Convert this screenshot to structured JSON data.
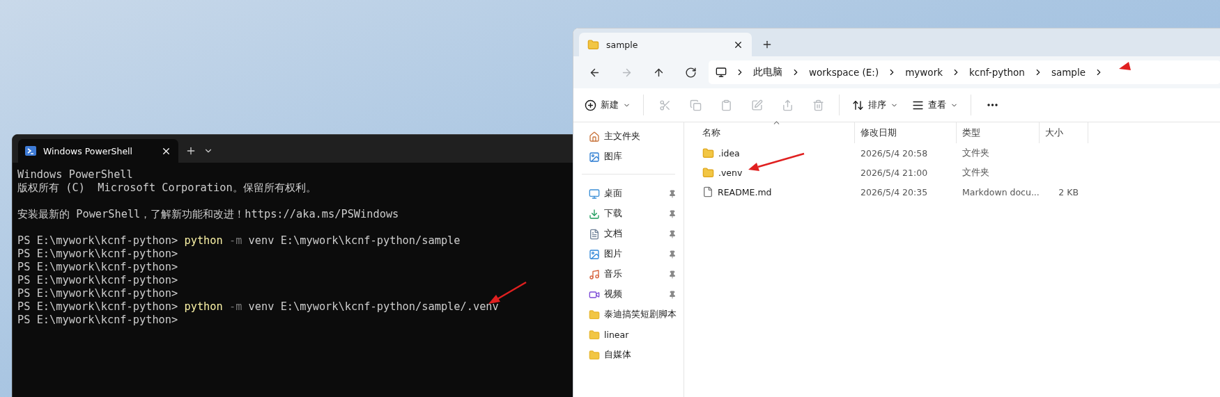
{
  "terminal": {
    "tab_title": "Windows PowerShell",
    "lines": [
      {
        "kind": "text",
        "text": "Windows PowerShell"
      },
      {
        "kind": "text",
        "text": "版权所有 (C)  Microsoft Corporation。保留所有权利。"
      },
      {
        "kind": "blank"
      },
      {
        "kind": "text",
        "text": "安装最新的 PowerShell，了解新功能和改进！https://aka.ms/PSWindows"
      },
      {
        "kind": "blank"
      },
      {
        "kind": "command",
        "prompt": "PS E:\\mywork\\kcnf-python>",
        "command": "python",
        "flag": "-m",
        "args": "venv E:\\mywork\\kcnf-python/sample"
      },
      {
        "kind": "prompt",
        "prompt": "PS E:\\mywork\\kcnf-python>"
      },
      {
        "kind": "prompt",
        "prompt": "PS E:\\mywork\\kcnf-python>"
      },
      {
        "kind": "prompt",
        "prompt": "PS E:\\mywork\\kcnf-python>"
      },
      {
        "kind": "prompt",
        "prompt": "PS E:\\mywork\\kcnf-python>"
      },
      {
        "kind": "command",
        "prompt": "PS E:\\mywork\\kcnf-python>",
        "command": "python",
        "flag": "-m",
        "args": "venv E:\\mywork\\kcnf-python/sample/.venv"
      },
      {
        "kind": "prompt",
        "prompt": "PS E:\\mywork\\kcnf-python>"
      }
    ]
  },
  "explorer": {
    "tab_title": "sample",
    "nav": [
      {
        "kind": "back",
        "disabled": false
      },
      {
        "kind": "forward",
        "disabled": true
      },
      {
        "kind": "up",
        "disabled": false
      },
      {
        "kind": "refresh",
        "disabled": false
      }
    ],
    "breadcrumbs": [
      "此电脑",
      "workspace (E:)",
      "mywork",
      "kcnf-python",
      "sample"
    ],
    "toolbar": [
      {
        "kind": "new",
        "label": "新建",
        "disabled": false
      },
      {
        "kind": "cut",
        "disabled": true
      },
      {
        "kind": "copy",
        "disabled": true
      },
      {
        "kind": "paste",
        "disabled": true
      },
      {
        "kind": "rename",
        "disabled": true
      },
      {
        "kind": "share",
        "disabled": true
      },
      {
        "kind": "delete",
        "disabled": true
      },
      {
        "kind": "sort",
        "label": "排序",
        "disabled": false
      },
      {
        "kind": "view",
        "label": "查看",
        "disabled": false
      },
      {
        "kind": "more",
        "disabled": false
      }
    ],
    "sidebar": [
      {
        "kind": "home",
        "label": "主文件夹",
        "pinned": false
      },
      {
        "kind": "gallery",
        "label": "图库",
        "pinned": false
      },
      {
        "kind": "divider"
      },
      {
        "kind": "desktop",
        "label": "桌面",
        "pinned": true
      },
      {
        "kind": "download",
        "label": "下载",
        "pinned": true
      },
      {
        "kind": "document",
        "label": "文档",
        "pinned": true
      },
      {
        "kind": "pictures",
        "label": "图片",
        "pinned": true
      },
      {
        "kind": "music",
        "label": "音乐",
        "pinned": true
      },
      {
        "kind": "video",
        "label": "视频",
        "pinned": true
      },
      {
        "kind": "folder",
        "label": "泰迪搞笑短剧脚本",
        "pinned": false
      },
      {
        "kind": "folder",
        "label": "linear",
        "pinned": false
      },
      {
        "kind": "folder",
        "label": "自媒体",
        "pinned": false
      }
    ],
    "columns": [
      "名称",
      "修改日期",
      "类型",
      "大小"
    ],
    "rows": [
      {
        "kind": "folder",
        "name": ".idea",
        "modified": "2026/5/4 20:58",
        "type": "文件夹",
        "size": ""
      },
      {
        "kind": "folder",
        "name": ".venv",
        "modified": "2026/5/4 21:00",
        "type": "文件夹",
        "size": ""
      },
      {
        "kind": "file",
        "name": "README.md",
        "modified": "2026/5/4 20:35",
        "type": "Markdown docu...",
        "size": "2 KB"
      }
    ]
  }
}
